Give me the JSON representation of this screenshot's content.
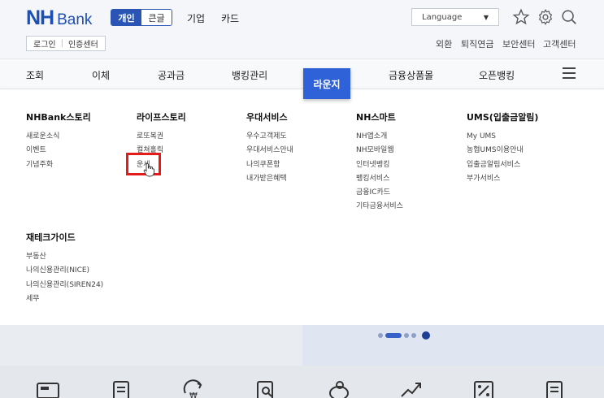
{
  "header": {
    "logo_nh": "NH",
    "logo_bank": "Bank",
    "seg_personal": "개인",
    "seg_check": "큰글",
    "nav_corporate": "기업",
    "nav_card": "카드",
    "login": "로그인",
    "cert_center": "인증센터",
    "language": "Language",
    "util": [
      "외환",
      "퇴직연금",
      "보안센터",
      "고객센터"
    ]
  },
  "gnb": {
    "items": [
      "조회",
      "이체",
      "공과금",
      "뱅킹관리",
      "라운지",
      "금융상품몰",
      "오픈뱅킹"
    ]
  },
  "mega": {
    "columns": [
      {
        "title": "NHBank스토리",
        "items": [
          "새로운소식",
          "이벤트",
          "기념주화"
        ]
      },
      {
        "title": "라이프스토리",
        "items": [
          "로또복권",
          "컬쳐홀릭",
          "운세"
        ]
      },
      {
        "title": "우대서비스",
        "items": [
          "우수고객제도",
          "우대서비스안내",
          "나의쿠폰함",
          "내가받은혜택"
        ]
      },
      {
        "title": "NH스마트",
        "items": [
          "NH앱소개",
          "NH모바일웹",
          "인터넷뱅킹",
          "뱅킹서비스",
          "금융IC카드",
          "기타금융서비스"
        ]
      },
      {
        "title": "UMS(입출금알림)",
        "items": [
          "My UMS",
          "농협UMS이용안내",
          "입출금알림서비스",
          "부가서비스"
        ]
      },
      {
        "title": "재테크가이드",
        "items": [
          "부동산",
          "나의신용관리(NICE)",
          "나의신용관리(SIREN24)",
          "세무"
        ]
      }
    ]
  },
  "colors": {
    "brand": "#1f4fb0",
    "active_tab": "#2f62d8",
    "highlight": "#e31b1b"
  },
  "icons": [
    "star-icon",
    "gear-icon",
    "search-icon",
    "menu-icon"
  ]
}
